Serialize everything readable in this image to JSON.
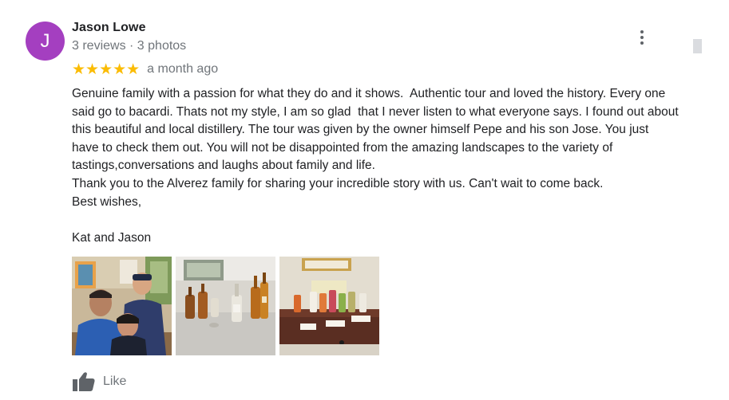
{
  "review": {
    "avatar_initial": "J",
    "avatar_color": "#a43fc0",
    "reviewer_name": "Jason Lowe",
    "reviewer_meta": "3 reviews · 3 photos",
    "stars": "★★★★★",
    "rating": 5,
    "date": "a month ago",
    "text": "Genuine family with a passion for what they do and it shows.  Authentic tour and loved the history. Every one said go to bacardi. Thats not my style, I am so glad  that I never listen to what everyone says. I found out about this beautiful and local distillery. The tour was given by the owner himself Pepe and his son Jose. You just have to check them out. You will not be disappointed from the amazing landscapes to the variety of tastings,conversations and laughs about family and life.\nThank you to the Alverez family for sharing your incredible story with us. Can't wait to come back.\nBest wishes,\n\nKat and Jason",
    "like_label": "Like",
    "star_color": "#fbbc04"
  }
}
